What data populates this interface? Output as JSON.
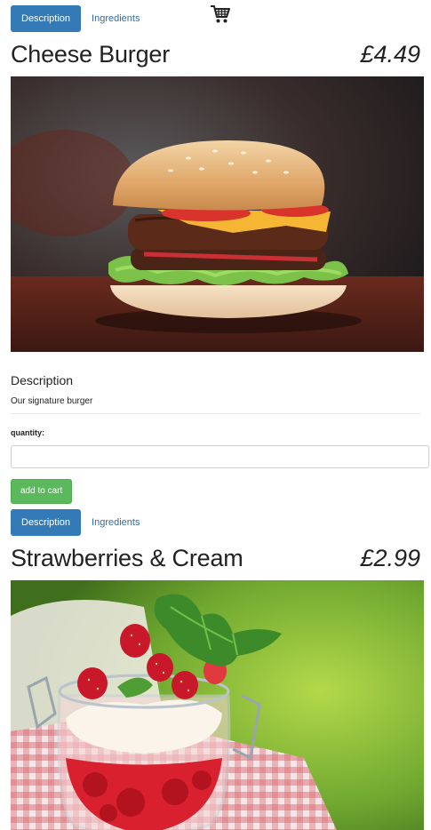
{
  "products": [
    {
      "tabs": [
        "Description",
        "Ingredients"
      ],
      "name": "Cheese Burger",
      "price": "£4.49",
      "description_heading": "Description",
      "description": "Our signature burger",
      "quantity_label": "quantity:",
      "quantity_value": "",
      "add_to_cart_label": "add to cart"
    },
    {
      "tabs": [
        "Description",
        "Ingredients"
      ],
      "name": "Strawberries & Cream",
      "price": "£2.99"
    }
  ],
  "icons": {
    "cart": "shopping-cart-icon"
  },
  "colors": {
    "tab_active_bg": "#337ab7",
    "link": "#2d6db0",
    "add_button": "#5cb85c"
  }
}
